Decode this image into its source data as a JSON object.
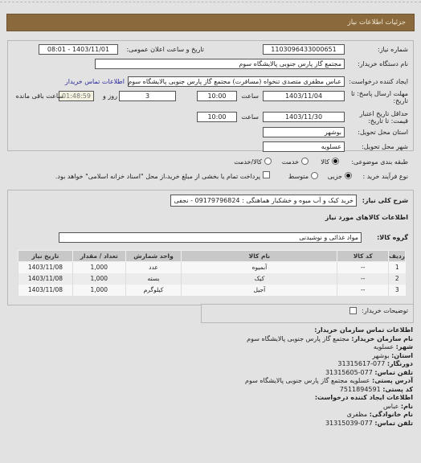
{
  "header": {
    "title": "جزئیات اطلاعات نیاز"
  },
  "details": {
    "need_number_label": "شماره نیاز:",
    "need_number": "1103096433000651",
    "announce_label": "تاریخ و ساعت اعلان عمومی:",
    "announce_value": "1403/11/01 - 08:01",
    "buyer_org_label": "نام دستگاه خریدار:",
    "buyer_org": "مجتمع گاز پارس جنوبی  پالایشگاه سوم",
    "creator_label": "ایجاد کننده درخواست:",
    "creator": "عباس مظفری متصدی تنخواه (مسافرت) مجتمع گاز پارس جنوبی  پالایشگاه سوم",
    "buyer_contact_link": "اطلاعات تماس خریدار",
    "reply_deadline_label_1": "مهلت ارسال پاسخ: تا",
    "reply_deadline_label_2": "تاریخ:",
    "reply_date": "1403/11/04",
    "time_label": "ساعت",
    "reply_time": "10:00",
    "days_value": "3",
    "days_label": "روز و",
    "remaining_time": "01:48:59",
    "remaining_label": "ساعت باقی مانده",
    "validity_label_1": "حداقل تاریخ اعتبار",
    "validity_label_2": "قیمت: تا تاریخ:",
    "validity_date": "1403/11/30",
    "validity_time": "10:00",
    "province_label": "استان محل تحویل:",
    "province": "بوشهر",
    "city_label": "شهر محل تحویل:",
    "city": "عسلویه",
    "category_label": "طبقه بندی موضوعی:",
    "category_options": [
      "کالا",
      "خدمت",
      "کالا/خدمت"
    ],
    "category_selected": "کالا",
    "process_label": "نوع فرآیند خرید :",
    "process_options": [
      "جزیی",
      "متوسط"
    ],
    "process_selected": "جزیی",
    "payment_note": "پرداخت تمام یا بخشی از مبلغ خرید،از محل \"اسناد خزانه اسلامی\" خواهد بود.",
    "payment_checked": false
  },
  "goods": {
    "summary_label": "شرح کلی نیاز:",
    "summary": "خرید کیک و آب میوه و خشکبار هماهنگی : 09179796824 - نجفی",
    "section_title": "اطلاعات کالاهای مورد نیاز",
    "group_label": "گروه کالا:",
    "group_value": "مواد غذائی و نوشیدنی",
    "columns": [
      "ردیف",
      "کد کالا",
      "نام کالا",
      "واحد شمارش",
      "تعداد / مقدار",
      "تاریخ نیاز"
    ],
    "rows": [
      {
        "idx": "1",
        "code": "--",
        "name": "آبمیوه",
        "unit": "عدد",
        "qty": "1,000",
        "date": "1403/11/08"
      },
      {
        "idx": "2",
        "code": "--",
        "name": "کیک",
        "unit": "بسته",
        "qty": "1,000",
        "date": "1403/11/08"
      },
      {
        "idx": "3",
        "code": "--",
        "name": "آجیل",
        "unit": "کیلوگرم",
        "qty": "1,000",
        "date": "1403/11/08"
      }
    ],
    "buyer_notes_label": "توضیحات خریدار:"
  },
  "contact": {
    "title": "اطلاعات تماس سازمان خریدار:",
    "org_label": "نام سازمان خریدار:",
    "org": "مجتمع گاز پارس جنوبی پالایشگاه سوم",
    "city_label": "شهر:",
    "city": "عسلویه",
    "province_label": "استان:",
    "province": "بوشهر",
    "fax_label": "دورنگار:",
    "fax": "077-31315617",
    "phone_label": "تلفن تماس:",
    "phone": "077-31315605",
    "address_label": "آدرس پستی:",
    "address": "عسلویه مجتمع گاز پارس جنوبی پالایشگاه سوم",
    "postal_label": "کد پستی:",
    "postal": "7511894591",
    "creator_title": "اطلاعات ایجاد کننده درخواست:",
    "first_name_label": "نام:",
    "first_name": "عباس",
    "last_name_label": "نام خانوادگی:",
    "last_name": "مظفری",
    "creator_phone_label": "تلفن تماس:",
    "creator_phone": "077-31315039"
  }
}
